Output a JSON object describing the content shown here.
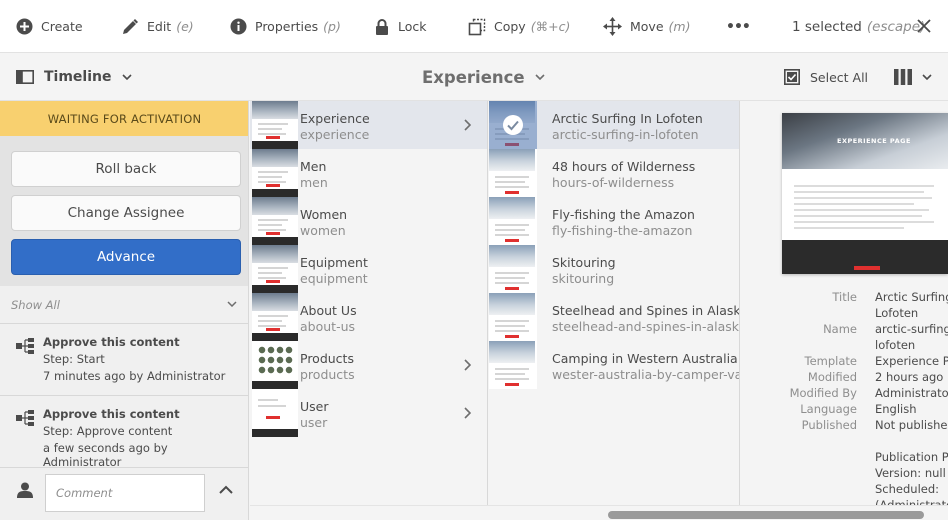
{
  "actionbar": {
    "create": {
      "label": "Create",
      "icon": "plus-circle-icon"
    },
    "edit": {
      "label": "Edit",
      "shortcut": "(e)",
      "icon": "pencil-icon"
    },
    "properties": {
      "label": "Properties",
      "shortcut": "(p)",
      "icon": "info-icon"
    },
    "lock": {
      "label": "Lock",
      "icon": "lock-icon"
    },
    "copy": {
      "label": "Copy",
      "shortcut": "(⌘+c)",
      "icon": "copy-icon"
    },
    "move": {
      "label": "Move",
      "shortcut": "(m)",
      "icon": "move-icon"
    },
    "more": {
      "label": "•••",
      "icon": "more-icon"
    },
    "selection": {
      "label": "1 selected",
      "shortcut": "(escape)"
    },
    "close_icon": "close-icon"
  },
  "header": {
    "rail_label": "Timeline",
    "title": "Experience",
    "select_all": "Select All"
  },
  "rail": {
    "banner": "WAITING FOR ACTIVATION",
    "buttons": {
      "rollback": "Roll back",
      "change_assignee": "Change Assignee",
      "advance": "Advance"
    },
    "filter": "Show All",
    "history": [
      {
        "title": "Approve this content",
        "step": "Step: Start",
        "time": "7 minutes ago by Administrator"
      },
      {
        "title": "Approve this content",
        "step": "Step: Approve content",
        "time": "a few seconds ago by Administrator"
      }
    ],
    "comment_placeholder": "Comment"
  },
  "column1": [
    {
      "title": "Experience",
      "name": "experience",
      "has_children": true,
      "active": true
    },
    {
      "title": "Men",
      "name": "men",
      "has_children": false
    },
    {
      "title": "Women",
      "name": "women",
      "has_children": false
    },
    {
      "title": "Equipment",
      "name": "equipment",
      "has_children": false
    },
    {
      "title": "About Us",
      "name": "about-us",
      "has_children": false
    },
    {
      "title": "Products",
      "name": "products",
      "has_children": true
    },
    {
      "title": "User",
      "name": "user",
      "has_children": true
    }
  ],
  "column2": [
    {
      "title": "Arctic Surfing In Lofoten",
      "name": "arctic-surfing-in-lofoten",
      "selected": true
    },
    {
      "title": "48 hours of Wilderness",
      "name": "hours-of-wilderness"
    },
    {
      "title": "Fly-fishing the Amazon",
      "name": "fly-fishing-the-amazon"
    },
    {
      "title": "Skitouring",
      "name": "skitouring"
    },
    {
      "title": "Steelhead and Spines in Alaska",
      "name": "steelhead-and-spines-in-alaska"
    },
    {
      "title": "Camping in Western Australia",
      "name": "wester-australia-by-camper-van"
    }
  ],
  "details": {
    "preview_text": "EXPERIENCE PAGE",
    "meta": [
      {
        "key": "Title",
        "values": [
          "Arctic Surfing In",
          "Lofoten"
        ]
      },
      {
        "key": "Name",
        "values": [
          "arctic-surfing-in-",
          "lofoten"
        ]
      },
      {
        "key": "Template",
        "values": [
          "Experience Page"
        ]
      },
      {
        "key": "Modified",
        "values": [
          "2 hours ago"
        ]
      },
      {
        "key": "Modified By",
        "values": [
          "Administrator"
        ]
      },
      {
        "key": "Language",
        "values": [
          "English"
        ]
      },
      {
        "key": "Published",
        "values": [
          "Not published"
        ]
      }
    ],
    "publication": [
      "Publication Pending",
      "Version: null",
      "Scheduled:",
      "(Administrator)"
    ]
  }
}
